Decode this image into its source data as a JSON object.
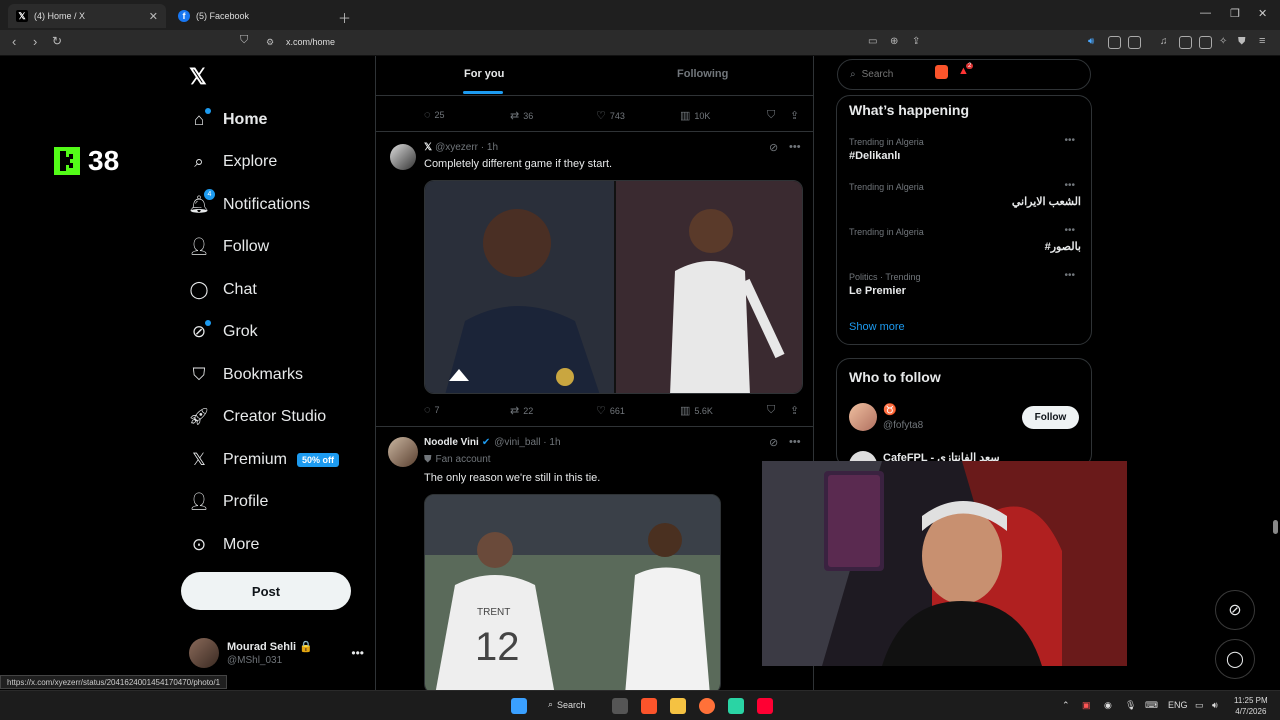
{
  "browser": {
    "tabs": [
      {
        "title": "(4) Home / X",
        "active": true
      },
      {
        "title": "(5) Facebook",
        "active": false
      }
    ],
    "url": "x.com/home",
    "status_url": "https://x.com/xyezerr/status/2041624001454170470/photo/1",
    "extension_badge": "2"
  },
  "kick": {
    "count": "38"
  },
  "sidebar": {
    "items": [
      {
        "label": "Home",
        "icon": "home-icon"
      },
      {
        "label": "Explore",
        "icon": "search-icon"
      },
      {
        "label": "Notifications",
        "icon": "bell-icon",
        "badge": "4"
      },
      {
        "label": "Follow",
        "icon": "person-plus-icon"
      },
      {
        "label": "Chat",
        "icon": "chat-bubble-icon"
      },
      {
        "label": "Grok",
        "icon": "grok-icon"
      },
      {
        "label": "Bookmarks",
        "icon": "bookmark-icon"
      },
      {
        "label": "Creator Studio",
        "icon": "rocket-icon"
      },
      {
        "label": "Premium",
        "icon": "x-logo-icon",
        "badge": "50% off"
      },
      {
        "label": "Profile",
        "icon": "person-icon"
      },
      {
        "label": "More",
        "icon": "more-circle-icon"
      }
    ],
    "post_label": "Post",
    "account": {
      "name": "Mourad Sehli 🔒",
      "handle": "@MShl_031"
    }
  },
  "feed": {
    "tabs": {
      "for_you": "For you",
      "following": "Following"
    },
    "prev_actions": {
      "replies": "25",
      "reposts": "36",
      "likes": "743",
      "views": "10K"
    },
    "tweets": [
      {
        "name": "𝕏",
        "handle": "@xyezerr",
        "time": "1h",
        "text": "Completely different game if they start.",
        "actions": {
          "replies": "7",
          "reposts": "22",
          "likes": "661",
          "views": "5.6K"
        }
      },
      {
        "name": "Noodle Vini",
        "handle": "@vini_ball",
        "time": "1h",
        "label": "Fan account",
        "text": "The only reason we're still in this tie."
      }
    ]
  },
  "right": {
    "search_placeholder": "Search",
    "happening_title": "What’s happening",
    "trends": [
      {
        "context": "Trending in Algeria",
        "title": "#Delikanlı",
        "rtl": false
      },
      {
        "context": "Trending in Algeria",
        "title": "الشعب الايراني",
        "rtl": true
      },
      {
        "context": "Trending in Algeria",
        "title": "#بالصور",
        "rtl": true
      },
      {
        "context": "Politics · Trending",
        "title": "Le Premier",
        "rtl": false
      }
    ],
    "show_more": "Show more",
    "who_to_follow_title": "Who to follow",
    "follow_suggestions": [
      {
        "name": "♉",
        "handle": "@fofyta8",
        "button": "Follow"
      },
      {
        "name": "CafeFPL - سعد الفانتازي",
        "handle": ""
      }
    ]
  },
  "taskbar": {
    "search_label": "Search",
    "lang": "ENG",
    "time": "11:25 PM",
    "date": "4/7/2026"
  },
  "colors": {
    "accent": "#1d9bf0",
    "kick_green": "#53fc18",
    "background": "#000000",
    "border": "#2f3336"
  }
}
